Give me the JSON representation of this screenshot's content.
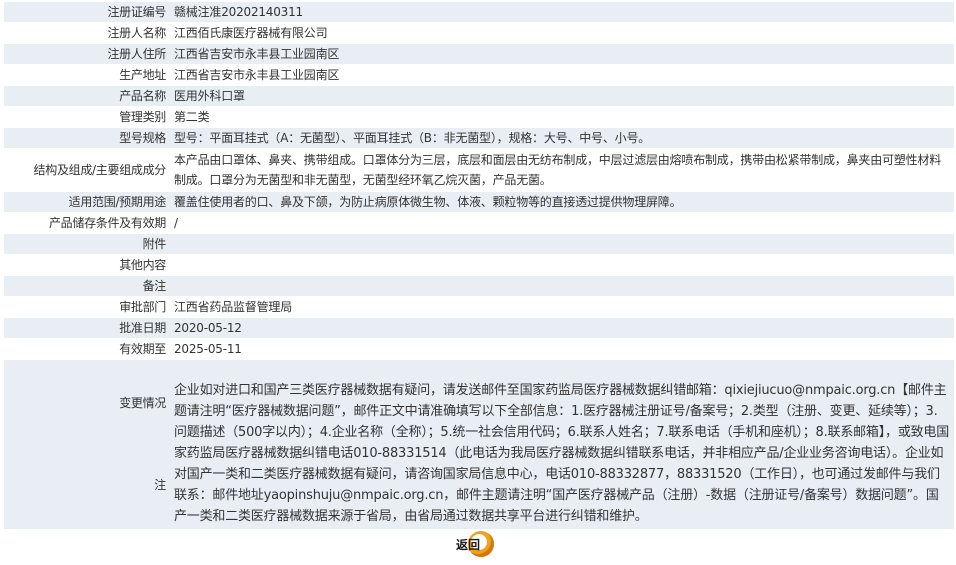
{
  "rows": [
    {
      "label": "注册证编号",
      "value": "赣械注准20202140311"
    },
    {
      "label": "注册人名称",
      "value": "江西佰氏康医疗器械有限公司"
    },
    {
      "label": "注册人住所",
      "value": "江西省吉安市永丰县工业园南区"
    },
    {
      "label": "生产地址",
      "value": "江西省吉安市永丰县工业园南区"
    },
    {
      "label": "产品名称",
      "value": "医用外科口罩"
    },
    {
      "label": "管理类别",
      "value": "第二类"
    },
    {
      "label": "型号规格",
      "value": "型号：平面耳挂式（A：无菌型）、平面耳挂式（B：非无菌型），规格：大号、中号、小号。"
    },
    {
      "label": "结构及组成/主要组成成分",
      "value": "本产品由口罩体、鼻夹、携带组成。口罩体分为三层，底层和面层由无纺布制成，中层过滤层由熔喷布制成，携带由松紧带制成，鼻夹由可塑性材料制成。口罩分为无菌型和非无菌型，无菌型经环氧乙烷灭菌，产品无菌。"
    },
    {
      "label": "适用范围/预期用途",
      "value": "覆盖住使用者的口、鼻及下颌，为防止病原体微生物、体液、颗粒物等的直接透过提供物理屏障。"
    },
    {
      "label": "产品储存条件及有效期",
      "value": "/"
    },
    {
      "label": "附件",
      "value": ""
    },
    {
      "label": "其他内容",
      "value": ""
    },
    {
      "label": "备注",
      "value": ""
    },
    {
      "label": "审批部门",
      "value": "江西省药品监督管理局"
    },
    {
      "label": "批准日期",
      "value": "2020-05-12"
    },
    {
      "label": "有效期至",
      "value": "2025-05-11"
    }
  ],
  "change": {
    "label": "变更情况",
    "value": ""
  },
  "note": {
    "label": "注",
    "value": "企业如对进口和国产三类医疗器械数据有疑问，请发送邮件至国家药监局医疗器械数据纠错邮箱：qixiejiucuo@nmpaic.org.cn【邮件主题请注明“医疗器械数据问题”，邮件正文中请准确填写以下全部信息：1.医疗器械注册证号/备案号；2.类型（注册、变更、延续等）；3.问题描述（500字以内）；4.企业名称（全称）；5.统一社会信用代码；6.联系人姓名；7.联系电话（手机和座机）；8.联系邮箱】，或致电国家药监局医疗器械数据纠错电话010-88331514（此电话为我局医疗器械数据纠错联系电话，并非相应产品/企业业务咨询电话）。企业如对国产一类和二类医疗器械数据有疑问，请咨询国家局信息中心，电话010-88332877，88331520（工作日），也可通过发邮件与我们联系：邮件地址yaopinshuju@nmpaic.org.cn，邮件主题请注明“国产医疗器械产品（注册）-数据（注册证号/备案号）数据问题”。国产一类和二类医疗器械数据来源于省局，由省局通过数据共享平台进行纠错和维护。"
  },
  "return_button": {
    "label": "返回"
  },
  "colors": {
    "row_alt": "#e8eef4",
    "button_accent": "#f0a21e"
  }
}
